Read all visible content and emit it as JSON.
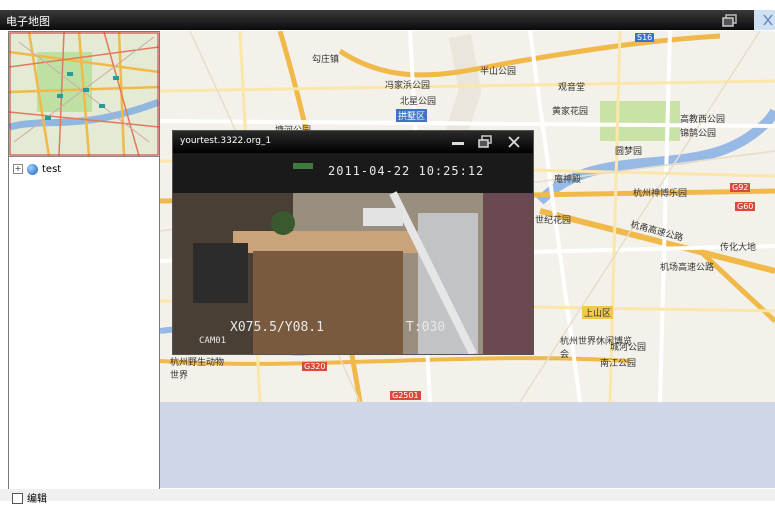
{
  "window": {
    "title": "电子地图"
  },
  "tree": {
    "root_label": "test",
    "expander_symbol": "+"
  },
  "map": {
    "labels": [
      "勾庄镇",
      "半山公园",
      "冯家浜公园",
      "北星公园",
      "观音堂",
      "拱墅区",
      "黄家花园",
      "高教西公园",
      "锦鹄公园",
      "塘河公园",
      "圆梦园",
      "庵神殿",
      "杭州神博乐园",
      "世纪花园",
      "传化大地",
      "机场高速公路",
      "杭甬高速公路",
      "上山区",
      "杭州世界休闲博览会",
      "城河公园",
      "南江公园",
      "杭州野生动物世界"
    ],
    "roads": [
      "S16",
      "G92",
      "G60",
      "G320",
      "G2501"
    ]
  },
  "video": {
    "title": "yourtest.3322.org_1",
    "timestamp": "2011-04-22  10:25:12",
    "camera": "CAM01",
    "coords": "X075.5/Y08.1",
    "time_code": "T:030"
  },
  "footer": {
    "edit_label": "编辑"
  },
  "colors": {
    "titlebar": "#111111",
    "map_bg": "#f3f1ea",
    "highway": "#f2c94c",
    "road_red": "#d84a3a",
    "river": "#97b9e6",
    "park": "#c9e3a7"
  }
}
